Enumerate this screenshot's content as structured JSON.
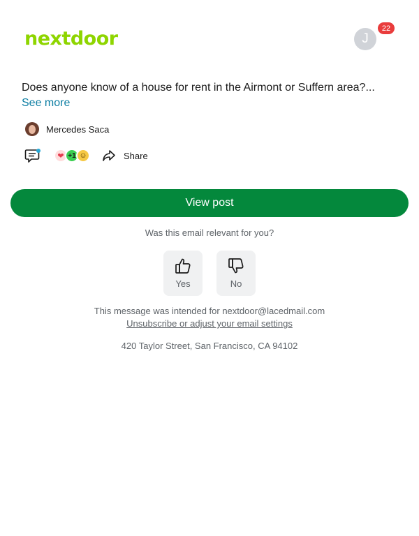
{
  "header": {
    "logo_text": "nextdoor",
    "avatar_initial": "J",
    "notification_count": "22"
  },
  "post": {
    "text": "Does anyone know of a house for rent in the Airmont or Suffern area?...",
    "see_more_label": "See more",
    "author": "Mercedes Saca",
    "reactions": [
      {
        "icon": "heart-icon",
        "glyph": "❤"
      },
      {
        "icon": "plus-one-icon",
        "glyph": "+1"
      },
      {
        "icon": "smile-icon",
        "glyph": "☺"
      }
    ],
    "share_label": "Share"
  },
  "cta": {
    "view_post_label": "View post"
  },
  "feedback": {
    "question": "Was this email relevant for you?",
    "yes_label": "Yes",
    "no_label": "No"
  },
  "footer": {
    "intended_for": "This message was intended for nextdoor@lacedmail.com",
    "unsubscribe_label": "Unsubscribe or adjust your email settings",
    "address": "420 Taylor Street, San Francisco, CA 94102"
  },
  "colors": {
    "brand_green": "#8ed500",
    "button_green": "#04883c",
    "link_blue": "#0d7ea3",
    "badge_red": "#e93c3c"
  }
}
